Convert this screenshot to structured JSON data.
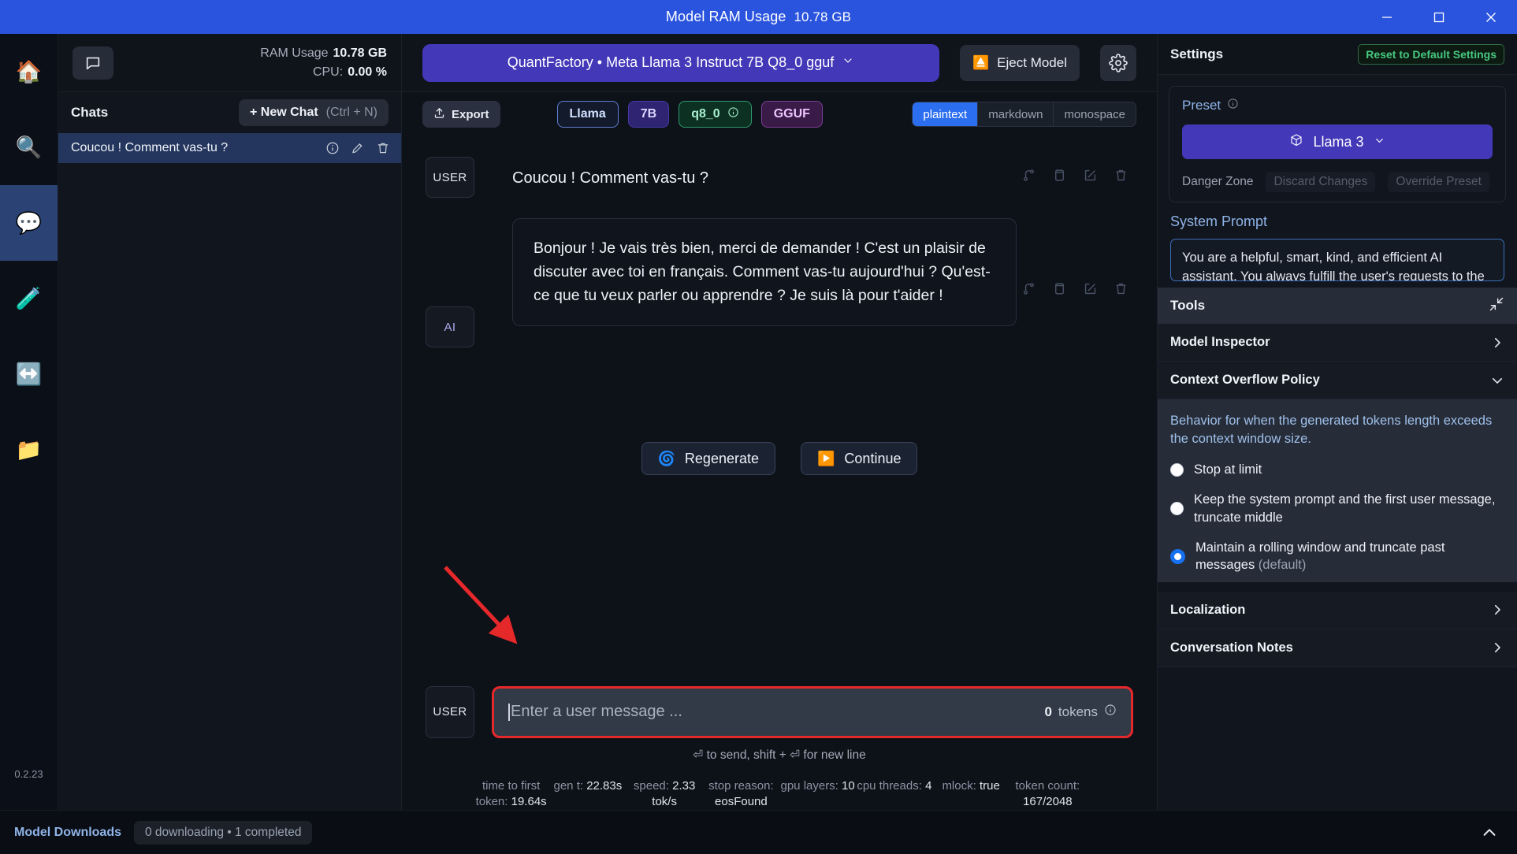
{
  "titlebar": {
    "title": "Model RAM Usage",
    "value": "10.78 GB",
    "minimize": "minimize-icon",
    "maximize": "maximize-icon",
    "close": "close-icon"
  },
  "rail": {
    "items": [
      {
        "name": "home",
        "glyph": "🏠",
        "active": false
      },
      {
        "name": "search",
        "glyph": "🔍",
        "active": false
      },
      {
        "name": "chat",
        "glyph": "💬",
        "active": true
      },
      {
        "name": "playground",
        "glyph": "🧪",
        "active": false
      },
      {
        "name": "local-server",
        "glyph": "↔️",
        "active": false
      },
      {
        "name": "my-models",
        "glyph": "📁",
        "active": false
      }
    ],
    "version": "0.2.23"
  },
  "sidebar": {
    "ram_label": "RAM Usage",
    "ram_value": "10.78 GB",
    "cpu_label": "CPU:",
    "cpu_value": "0.00 %",
    "chats_label": "Chats",
    "new_chat_label": "+ New Chat",
    "new_chat_shortcut": "(Ctrl + N)",
    "chat_items": [
      {
        "title": "Coucou ! Comment vas-tu ?",
        "selected": true
      }
    ]
  },
  "topbar": {
    "model_name": "QuantFactory • Meta Llama 3 Instruct 7B Q8_0 gguf",
    "eject_label": "Eject Model",
    "settings_icon": "gear-icon"
  },
  "chipbar": {
    "export_label": "Export",
    "chips": [
      {
        "label": "Llama",
        "kind": "llama"
      },
      {
        "label": "7B",
        "kind": "size"
      },
      {
        "label": "q8_0",
        "kind": "quant",
        "info": true
      },
      {
        "label": "GGUF",
        "kind": "fmt"
      }
    ],
    "segments": [
      {
        "label": "plaintext",
        "active": true
      },
      {
        "label": "markdown",
        "active": false
      },
      {
        "label": "monospace",
        "active": false
      }
    ]
  },
  "conversation": {
    "messages": [
      {
        "role": "USER",
        "text": "Coucou ! Comment vas-tu ?"
      },
      {
        "role": "AI",
        "text": "Bonjour ! Je vais très bien, merci de demander ! C'est un plaisir de discuter avec toi en français. Comment vas-tu aujourd'hui ? Qu'est-ce que tu veux parler ou apprendre ? Je suis là pour t'aider !"
      }
    ],
    "regenerate_label": "Regenerate",
    "continue_label": "Continue"
  },
  "composer": {
    "role_badge": "USER",
    "placeholder": "Enter a user message ...",
    "token_count": "0",
    "token_label": "tokens",
    "hint": "⏎ to send, shift + ⏎ for new line"
  },
  "stats": [
    {
      "label": "time to first token:",
      "value": "19.64s"
    },
    {
      "label": "gen t:",
      "value": "22.83s"
    },
    {
      "label": "speed:",
      "value": "2.33 tok/s"
    },
    {
      "label": "stop reason:",
      "value": "eosFound"
    },
    {
      "label": "gpu layers:",
      "value": "10"
    },
    {
      "label": "cpu threads:",
      "value": "4"
    },
    {
      "label": "mlock:",
      "value": "true"
    },
    {
      "label": "token count:",
      "value": "167/2048"
    }
  ],
  "settings": {
    "title": "Settings",
    "reset_label": "Reset to Default Settings",
    "preset_label": "Preset",
    "preset_value": "Llama 3",
    "danger_zone_label": "Danger Zone",
    "discard_label": "Discard Changes",
    "override_label": "Override Preset",
    "system_prompt_label": "System Prompt",
    "system_prompt_value": "You are a helpful, smart, kind, and efficient AI assistant. You always fulfill the user's requests to the best of your ability.",
    "tools_label": "Tools",
    "rows": [
      {
        "label": "Model Inspector",
        "chevron": "right"
      },
      {
        "label": "Context Overflow Policy",
        "chevron": "down"
      }
    ],
    "policy": {
      "description": "Behavior for when the generated tokens length exceeds the context window size.",
      "options": [
        {
          "label": "Stop at limit",
          "suffix": "",
          "selected": false
        },
        {
          "label": "Keep the system prompt and the first user message, truncate middle",
          "suffix": "",
          "selected": false
        },
        {
          "label": "Maintain a rolling window and truncate past messages",
          "suffix": " (default)",
          "selected": true
        }
      ]
    },
    "bottom_rows": [
      {
        "label": "Localization",
        "chevron": "right"
      },
      {
        "label": "Conversation Notes",
        "chevron": "right"
      }
    ]
  },
  "footer": {
    "downloads_label": "Model Downloads",
    "downloads_status": "0 downloading • 1 completed",
    "collapse_icon": "chevron-up-icon"
  },
  "colors": {
    "titlebar": "#2a54dd",
    "accent_purple": "#4338b8",
    "accent_blue": "#2b6ef0",
    "green": "#46c97f",
    "annotation_red": "#e5282a"
  }
}
